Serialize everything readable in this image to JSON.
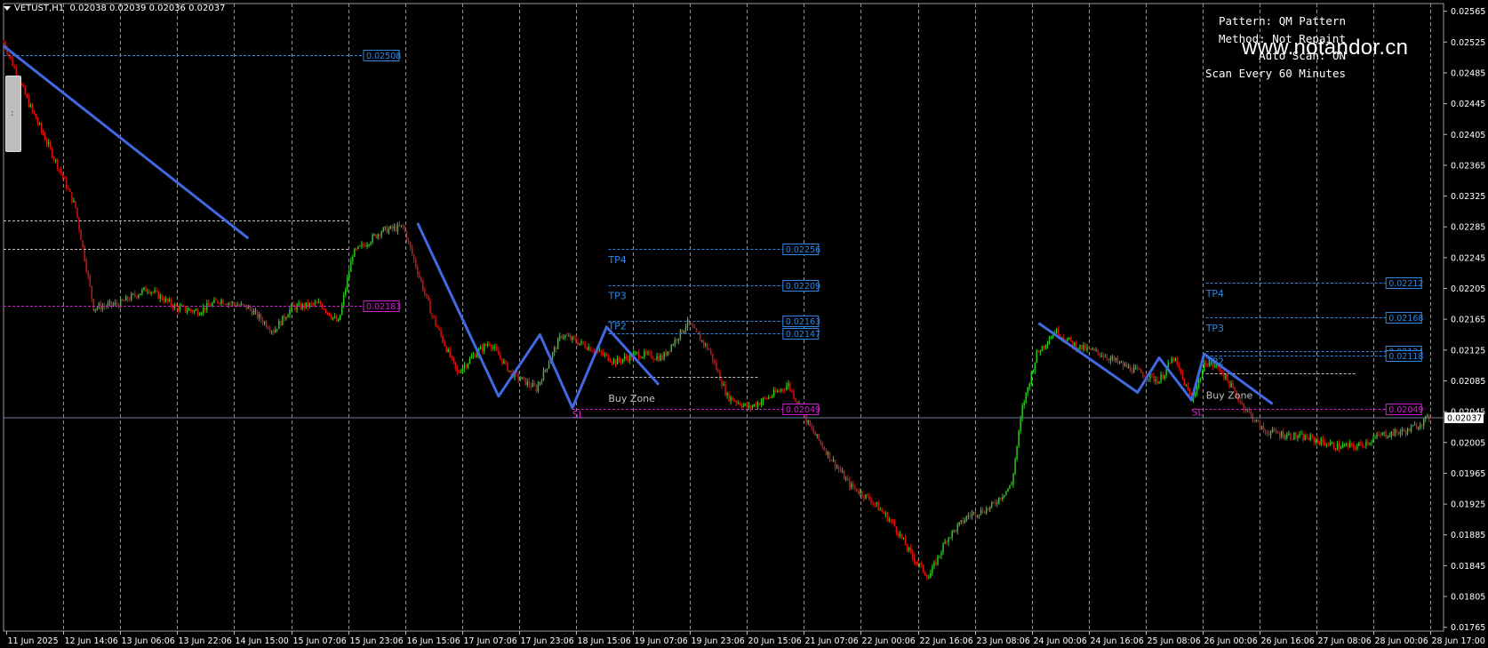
{
  "symbol_info": {
    "symbol": "VETUST,H1",
    "open": "0.02038",
    "high": "0.02039",
    "low": "0.02036",
    "close": "0.02037"
  },
  "panel": {
    "pattern": "Pattern: QM Pattern",
    "method": "Method: Not Repaint",
    "autoscan": "Auto Scan: ON",
    "scan_every": "Scan Every 60 Minutes"
  },
  "watermark": "www.notandor.cn",
  "colors": {
    "background": "#000000",
    "bull": "#2ecc1f",
    "bear": "#e01010",
    "zigzag": "#4169e1",
    "level_blue": "#2f87e0",
    "level_magenta": "#cc22cc",
    "grid": "#c0c0c0",
    "bid": "#6f7f9f"
  },
  "chart_data": {
    "type": "candlestick",
    "ylim": [
      0.0176,
      0.02575
    ],
    "y_ticks": [
      "0.02565",
      "0.02525",
      "0.02485",
      "0.02445",
      "0.02405",
      "0.02365",
      "0.02325",
      "0.02285",
      "0.02245",
      "0.02205",
      "0.02165",
      "0.02125",
      "0.02085",
      "0.02045",
      "0.02005",
      "0.01965",
      "0.01925",
      "0.01885",
      "0.01845",
      "0.01805",
      "0.01765"
    ],
    "x_ticks": [
      "11 Jun 2025",
      "12 Jun 14:06",
      "13 Jun 06:06",
      "13 Jun 22:06",
      "14 Jun 15:00",
      "15 Jun 07:06",
      "15 Jun 23:06",
      "16 Jun 15:06",
      "17 Jun 07:06",
      "17 Jun 23:06",
      "18 Jun 15:06",
      "19 Jun 07:06",
      "19 Jun 23:06",
      "20 Jun 15:06",
      "21 Jun 07:06",
      "22 Jun 00:06",
      "22 Jun 16:06",
      "23 Jun 08:06",
      "24 Jun 00:06",
      "24 Jun 16:06",
      "25 Jun 08:06",
      "26 Jun 00:06",
      "26 Jun 16:06",
      "27 Jun 08:06",
      "28 Jun 00:06",
      "28 Jun 17:00"
    ],
    "current_price": "0.02037",
    "path_points": [
      [
        0,
        0.02525
      ],
      [
        14,
        0.02445
      ],
      [
        24,
        0.02395
      ],
      [
        32,
        0.02355
      ],
      [
        40,
        0.0231
      ],
      [
        50,
        0.0218
      ],
      [
        64,
        0.02185
      ],
      [
        80,
        0.02205
      ],
      [
        96,
        0.0218
      ],
      [
        108,
        0.02175
      ],
      [
        120,
        0.0219
      ],
      [
        136,
        0.0218
      ],
      [
        150,
        0.0215
      ],
      [
        160,
        0.0218
      ],
      [
        176,
        0.02185
      ],
      [
        186,
        0.0216
      ],
      [
        194,
        0.0225
      ],
      [
        210,
        0.0228
      ],
      [
        222,
        0.02285
      ],
      [
        238,
        0.0217
      ],
      [
        252,
        0.02095
      ],
      [
        262,
        0.0212
      ],
      [
        270,
        0.02135
      ],
      [
        282,
        0.02095
      ],
      [
        296,
        0.02075
      ],
      [
        310,
        0.02145
      ],
      [
        324,
        0.0213
      ],
      [
        340,
        0.0211
      ],
      [
        352,
        0.0212
      ],
      [
        366,
        0.02115
      ],
      [
        380,
        0.0216
      ],
      [
        392,
        0.02125
      ],
      [
        402,
        0.02065
      ],
      [
        414,
        0.0205
      ],
      [
        426,
        0.02065
      ],
      [
        436,
        0.0208
      ],
      [
        448,
        0.02025
      ],
      [
        458,
        0.0199
      ],
      [
        470,
        0.0195
      ],
      [
        482,
        0.0193
      ],
      [
        494,
        0.019
      ],
      [
        504,
        0.0186
      ],
      [
        514,
        0.0183
      ],
      [
        524,
        0.0188
      ],
      [
        536,
        0.0191
      ],
      [
        548,
        0.0192
      ],
      [
        560,
        0.0195
      ],
      [
        566,
        0.0205
      ],
      [
        574,
        0.0212
      ],
      [
        584,
        0.0215
      ],
      [
        596,
        0.0213
      ],
      [
        610,
        0.0212
      ],
      [
        622,
        0.02105
      ],
      [
        632,
        0.02095
      ],
      [
        642,
        0.02085
      ],
      [
        650,
        0.02115
      ],
      [
        660,
        0.0206
      ],
      [
        668,
        0.0211
      ],
      [
        676,
        0.021
      ],
      [
        688,
        0.02055
      ],
      [
        700,
        0.0202
      ],
      [
        712,
        0.02015
      ],
      [
        726,
        0.0201
      ],
      [
        740,
        0.02
      ],
      [
        752,
        0.02
      ],
      [
        766,
        0.02015
      ],
      [
        780,
        0.0202
      ],
      [
        792,
        0.02037
      ]
    ],
    "zigzag": [
      [
        [
          0,
          0.0252
        ],
        [
          136,
          0.0227
        ]
      ],
      [
        [
          230,
          0.0229
        ],
        [
          275,
          0.02065
        ],
        [
          298,
          0.02145
        ],
        [
          316,
          0.0205
        ],
        [
          335,
          0.02155
        ],
        [
          364,
          0.0208
        ]
      ],
      [
        [
          575,
          0.0216
        ],
        [
          630,
          0.0207
        ],
        [
          642,
          0.02115
        ],
        [
          660,
          0.0206
        ],
        [
          667,
          0.0212
        ],
        [
          705,
          0.02055
        ]
      ]
    ],
    "levels": [
      {
        "x1": 0,
        "x2": 200,
        "y": 0.02508,
        "label": "0.02508",
        "color": "blue",
        "box": true
      },
      {
        "x1": 0,
        "x2": 192,
        "y": 0.02293,
        "label": "",
        "color": "gray",
        "box": false
      },
      {
        "x1": 0,
        "x2": 192,
        "y": 0.02256,
        "label": "",
        "color": "gray",
        "box": false
      },
      {
        "x1": 0,
        "x2": 200,
        "y": 0.02183,
        "label": "0.02183",
        "color": "magenta",
        "box": true
      },
      {
        "x1": 336,
        "x2": 433,
        "y": 0.02256,
        "label": "0.02256",
        "color": "blue",
        "box": true
      },
      {
        "x1": 336,
        "x2": 433,
        "y": 0.02209,
        "label": "0.02209",
        "color": "blue",
        "box": true
      },
      {
        "x1": 336,
        "x2": 433,
        "y": 0.02163,
        "label": "0.02163",
        "color": "blue",
        "box": true
      },
      {
        "x1": 336,
        "x2": 433,
        "y": 0.02147,
        "label": "0.02147",
        "color": "blue",
        "box": true
      },
      {
        "x1": 336,
        "x2": 420,
        "y": 0.0209,
        "label": "",
        "color": "gray",
        "box": false
      },
      {
        "x1": 316,
        "x2": 433,
        "y": 0.02049,
        "label": "0.02049",
        "color": "magenta",
        "box": true
      },
      {
        "x1": 668,
        "x2": 768,
        "y": 0.02212,
        "label": "0.02212",
        "color": "blue",
        "box": true
      },
      {
        "x1": 668,
        "x2": 768,
        "y": 0.02168,
        "label": "0.02168",
        "color": "blue",
        "box": true
      },
      {
        "x1": 668,
        "x2": 768,
        "y": 0.02124,
        "label": "0.02124",
        "color": "blue",
        "box": true
      },
      {
        "x1": 668,
        "x2": 768,
        "y": 0.02118,
        "label": "0.02118",
        "color": "blue",
        "box": true
      },
      {
        "x1": 668,
        "x2": 752,
        "y": 0.02095,
        "label": "",
        "color": "gray",
        "box": false
      },
      {
        "x1": 660,
        "x2": 768,
        "y": 0.02049,
        "label": "0.02049",
        "color": "magenta",
        "box": true
      }
    ],
    "annotations": [
      {
        "x": 336,
        "y": 0.02238,
        "text": "TP4",
        "color": "blue"
      },
      {
        "x": 336,
        "y": 0.02191,
        "text": "TP3",
        "color": "blue"
      },
      {
        "x": 336,
        "y": 0.02152,
        "text": "TP2",
        "color": "blue"
      },
      {
        "x": 336,
        "y": 0.02058,
        "text": "Buy Zone",
        "color": "gray"
      },
      {
        "x": 316,
        "y": 0.02037,
        "text": "SL",
        "color": "magenta"
      },
      {
        "x": 668,
        "y": 0.02194,
        "text": "TP4",
        "color": "blue"
      },
      {
        "x": 668,
        "y": 0.02149,
        "text": "TP3",
        "color": "blue"
      },
      {
        "x": 668,
        "y": 0.02106,
        "text": "TP2",
        "color": "blue"
      },
      {
        "x": 668,
        "y": 0.02062,
        "text": "Buy Zone",
        "color": "gray"
      },
      {
        "x": 660,
        "y": 0.0204,
        "text": "SL",
        "color": "magenta"
      }
    ]
  }
}
